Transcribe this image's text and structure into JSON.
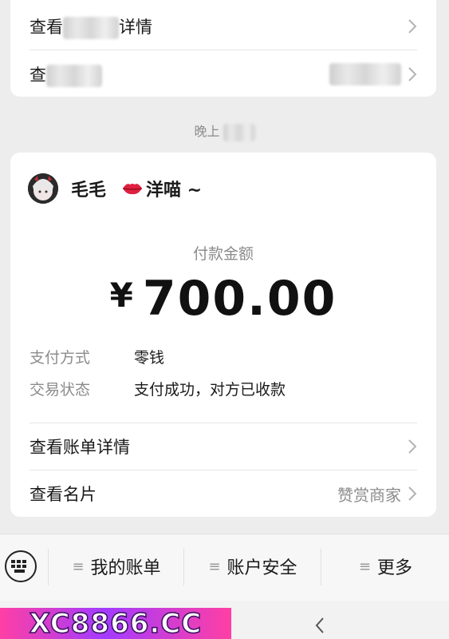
{
  "top_card": {
    "row1_label_prefix": "查看",
    "row1_label_suffix": "详情",
    "row2_label_prefix": "查"
  },
  "time_label": {
    "prefix": "晚上"
  },
  "payment": {
    "merchant_name": "毛毛",
    "merchant_sub": "洋喵 ~",
    "amount_label": "付款金额",
    "currency": "¥",
    "amount": "700.00",
    "method_key": "支付方式",
    "method_value": "零钱",
    "status_key": "交易状态",
    "status_value": "支付成功，对方已收款",
    "bill_details_label": "查看账单详情",
    "card_label": "查看名片",
    "card_value": "赞赏商家"
  },
  "bottom_nav": {
    "items": [
      {
        "label": "我的账单"
      },
      {
        "label": "账户安全"
      },
      {
        "label": "更多"
      }
    ]
  },
  "watermark": {
    "text": "XC8866.CC"
  },
  "colors": {
    "page_bg": "#ededed",
    "card_bg": "#ffffff",
    "muted": "#8c8c8c"
  }
}
